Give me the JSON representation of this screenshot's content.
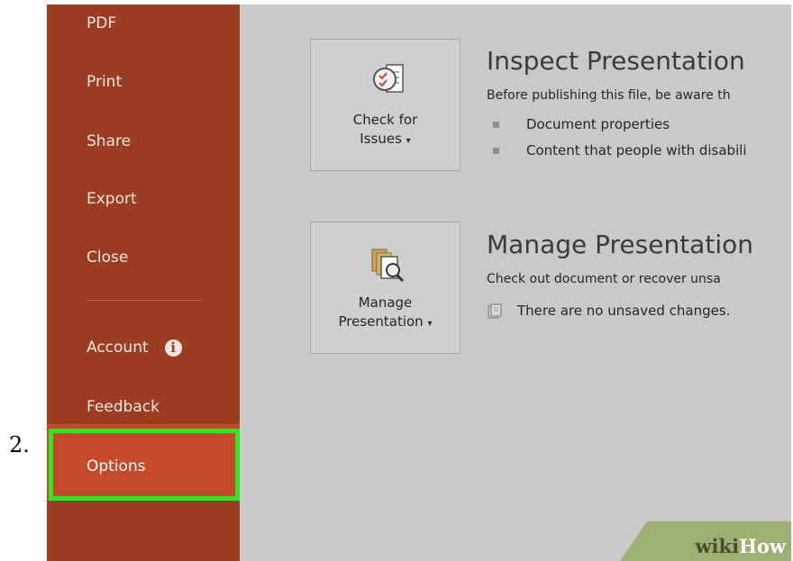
{
  "step": {
    "number": "2."
  },
  "sidebar": {
    "items": [
      {
        "label": "PDF"
      },
      {
        "label": "Print"
      },
      {
        "label": "Share"
      },
      {
        "label": "Export"
      },
      {
        "label": "Close"
      }
    ],
    "account": "Account",
    "feedback": "Feedback",
    "options": "Options"
  },
  "inspect": {
    "button_line1": "Check for",
    "button_line2": "Issues",
    "title": "Inspect Presentation",
    "description": "Before publishing this file, be aware th",
    "bullets": [
      "Document properties",
      "Content that people with disabili"
    ]
  },
  "manage": {
    "button_line1": "Manage",
    "button_line2": "Presentation",
    "title": "Manage Presentation",
    "description": "Check out document or recover unsa",
    "status": "There are no unsaved changes."
  },
  "watermark": {
    "wiki": "wiki",
    "how": "How"
  },
  "colors": {
    "sidebar": "#9a3d22",
    "selected": "#c6492b",
    "highlight": "#2ee824",
    "content_bg": "#c9c9c9"
  }
}
